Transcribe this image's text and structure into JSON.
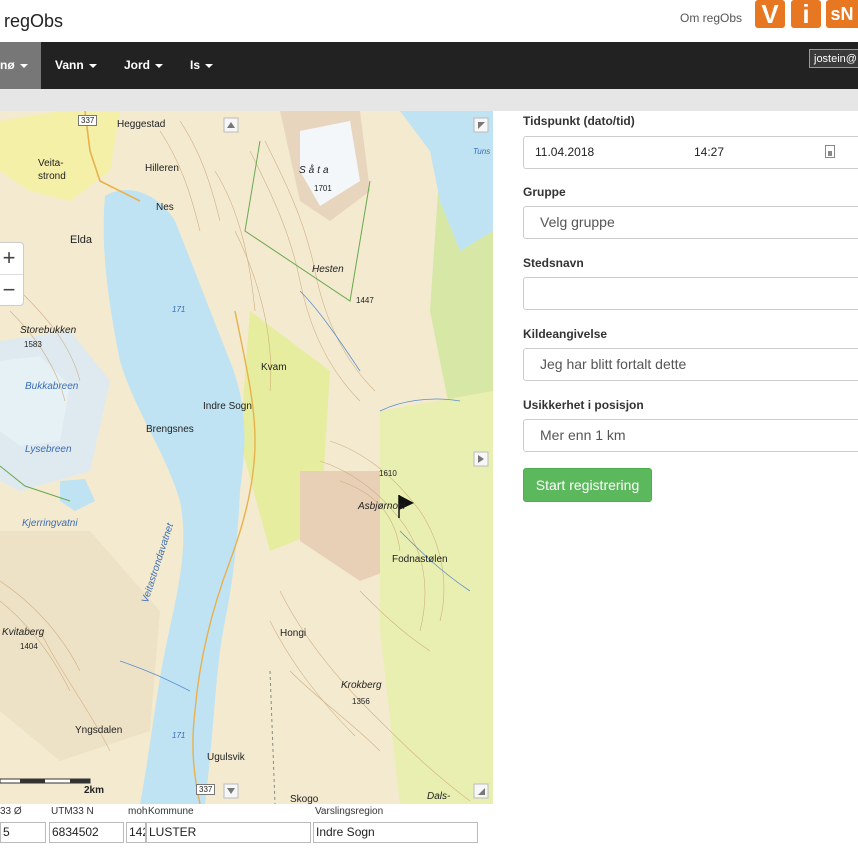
{
  "header": {
    "brand": "regObs",
    "about_link": "Om regObs",
    "logo_v": "V",
    "logo_i": "i",
    "logo_sn": "sN"
  },
  "nav": {
    "items": [
      {
        "label": "nø",
        "active": true
      },
      {
        "label": "Vann",
        "active": false
      },
      {
        "label": "Jord",
        "active": false
      },
      {
        "label": "Is",
        "active": false
      }
    ],
    "user": "jostein@"
  },
  "map": {
    "zoom_in": "+",
    "zoom_out": "−",
    "scale_label": "2km",
    "labels": {
      "heggestad": "Heggestad",
      "veitastrond": "Veita-\nstrond",
      "hilleren": "Hilleren",
      "nes": "Nes",
      "elda": "Elda",
      "saata": "Såta",
      "h1701": "1701",
      "hesten": "Hesten",
      "h1447": "1447",
      "storebukken": "Storebukken",
      "h1583": "1583",
      "bukkabreen": "Bukkabreen",
      "kvam": "Kvam",
      "indre_sogn": "Indre Sogn",
      "brengsnes": "Brengsnes",
      "lysebreen": "Lysebreen",
      "h1610": "1610",
      "asbjornosi": "Asbjørnosi",
      "kjerringvatni": "Kjerringvatni",
      "fodnastolen": "Fodnastølen",
      "veitastrondavatnet": "Veitastrondavatnet",
      "kvitaberg": "Kvitaberg",
      "h1404": "1404",
      "hongi": "Hongi",
      "krokberg": "Krokberg",
      "h1356": "1356",
      "yngsdalen": "Yngsdalen",
      "ugulsvik": "Ugulsvik",
      "skogo": "Skogo",
      "dals": "Dals-",
      "tuns": "Tuns",
      "lake171a": "171",
      "lake171b": "171",
      "road337a": "337",
      "road337b": "337"
    }
  },
  "coords": {
    "east_label": "33 Ø",
    "north_label": "UTM33 N",
    "moh_label": "moh",
    "kommune_label": "Kommune",
    "region_label": "Varslingsregion",
    "east_value": "5",
    "north_value": "6834502",
    "moh_value": "142",
    "kommune_value": "LUSTER",
    "region_value": "Indre Sogn"
  },
  "form": {
    "time_label": "Tidspunkt (dato/tid)",
    "date_value": "11.04.2018",
    "time_value": "14:27",
    "group_label": "Gruppe",
    "group_value": "Velg gruppe",
    "place_label": "Stedsnavn",
    "place_value": "",
    "source_label": "Kildeangivelse",
    "source_value": "Jeg har blitt fortalt dette",
    "uncertainty_label": "Usikkerhet i posisjon",
    "uncertainty_value": "Mer enn 1 km",
    "start_button": "Start registrering"
  },
  "colors": {
    "accent_orange": "#e87722",
    "navbar": "#222222",
    "start_green": "#5cb85c",
    "water": "#bfe3f2"
  }
}
